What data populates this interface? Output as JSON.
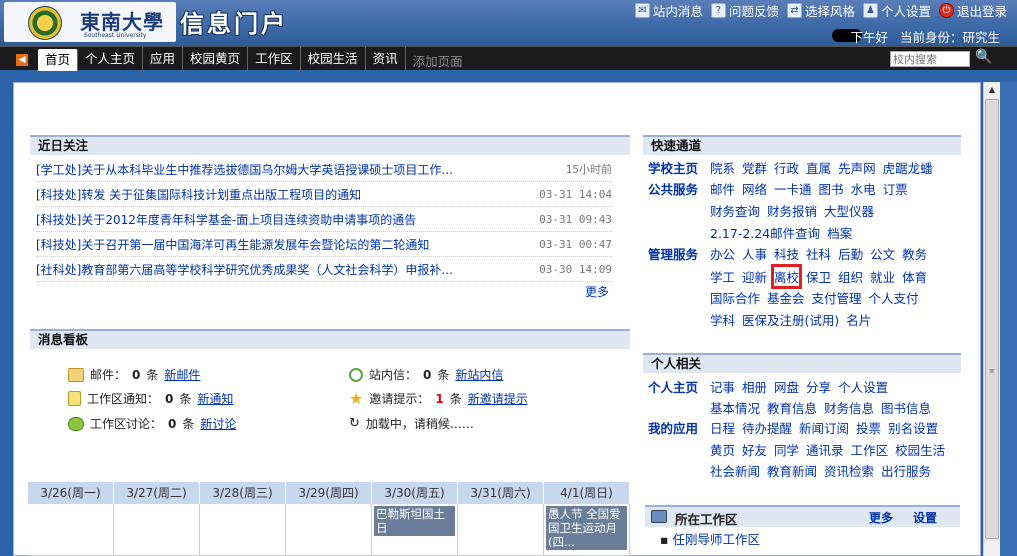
{
  "header": {
    "logo_name": "東南大學",
    "logo_sub": "Southeast University",
    "portal_title": "信息门户",
    "topnav": [
      {
        "label": "站内消息",
        "icon": "message-icon"
      },
      {
        "label": "问题反馈",
        "icon": "feedback-icon"
      },
      {
        "label": "选择风格",
        "icon": "style-icon"
      },
      {
        "label": "个人设置",
        "icon": "user-settings-icon"
      },
      {
        "label": "退出登录",
        "icon": "power-icon"
      }
    ],
    "greeting": "下午好",
    "identity": "当前身份：研究生"
  },
  "tabs": [
    "首页",
    "个人主页",
    "应用",
    "校园黄页",
    "工作区",
    "校园生活",
    "资讯"
  ],
  "add_page": "添加页面",
  "search": {
    "placeholder": "校内搜索"
  },
  "news": {
    "title": "近日关注",
    "items": [
      {
        "title": "[学工处]关于从本科毕业生中推荐选拔德国乌尔姆大学英语授课硕士项目工作...",
        "time": "15小时前"
      },
      {
        "title": "[科技处]转发 关于征集国际科技计划重点出版工程项目的通知",
        "time": "03-31 14:04"
      },
      {
        "title": "[科技处]关于2012年度青年科学基金-面上项目连续资助申请事项的通告",
        "time": "03-31 09:43"
      },
      {
        "title": "[科技处]关于召开第一届中国海洋可再生能源发展年会暨论坛的第二轮通知",
        "time": "03-31 00:47"
      },
      {
        "title": "[社科处]教育部第六届高等学校科学研究优秀成果奖（人文社会科学）申报补...",
        "time": "03-30 14:09"
      }
    ],
    "more": "更多"
  },
  "board": {
    "title": "消息看板",
    "mail": {
      "label": "邮件：",
      "count": "0",
      "unit": "条",
      "link": "新邮件"
    },
    "notice": {
      "label": "工作区通知：",
      "count": "0",
      "unit": "条",
      "link": "新通知"
    },
    "discuss": {
      "label": "工作区讨论：",
      "count": "0",
      "unit": "条",
      "link": "新讨论"
    },
    "site_msg": {
      "label": "站内信：",
      "count": "0",
      "unit": "条",
      "link": "新站内信"
    },
    "invite": {
      "label": "邀请提示：",
      "count": "1",
      "unit": "条",
      "link": "新邀请提示"
    },
    "loading": "加载中，请稍候……"
  },
  "calendar": {
    "days": [
      "3/26(周一)",
      "3/27(周二)",
      "3/28(周三)",
      "3/29(周四)",
      "3/30(周五)",
      "3/31(周六)",
      "4/1(周日)"
    ],
    "events": [
      {
        "day_index": 4,
        "text": "巴勒斯坦国土日"
      },
      {
        "day_index": 6,
        "text": "愚人节 全国爱国卫生运动月(四..."
      }
    ]
  },
  "quick": {
    "title": "快速通道",
    "school_home": {
      "label": "学校主页",
      "links": [
        "院系",
        "党群",
        "行政",
        "直属",
        "先声网",
        "虎踞龙蟠"
      ]
    },
    "public": {
      "label": "公共服务",
      "links": [
        "邮件",
        "网络",
        "一卡通",
        "图书",
        "水电",
        "订票"
      ],
      "links2": [
        "财务查询",
        "财务报销",
        "大型仪器"
      ],
      "links3": [
        "2.17-2.24邮件查询",
        "档案"
      ]
    },
    "manage": {
      "label": "管理服务",
      "links": [
        "办公",
        "人事",
        "科技",
        "社科",
        "后勤",
        "公文",
        "教务"
      ],
      "links2": [
        "学工",
        "迎新",
        "离校",
        "保卫",
        "组织",
        "就业",
        "体育"
      ],
      "links3": [
        "国际合作",
        "基金会",
        "支付管理",
        "个人支付"
      ],
      "links4": [
        "学科",
        "医保及注册(试用)",
        "名片"
      ]
    }
  },
  "personal": {
    "title": "个人相关",
    "home": {
      "label": "个人主页",
      "links": [
        "记事",
        "相册",
        "网盘",
        "分享",
        "个人设置"
      ],
      "links2": [
        "基本情况",
        "教育信息",
        "财务信息",
        "图书信息"
      ]
    },
    "apps": {
      "label": "我的应用",
      "links": [
        "日程",
        "待办提醒",
        "新闻订阅",
        "投票",
        "别名设置"
      ],
      "links2": [
        "黄页",
        "好友",
        "同学",
        "通讯录",
        "工作区",
        "校园生活"
      ],
      "links3": [
        "社会新闻",
        "教育新闻",
        "资讯检索",
        "出行服务"
      ]
    }
  },
  "workspace": {
    "title": "所在工作区",
    "more": "更多",
    "settings": "设置",
    "item": "任刚导师工作区"
  }
}
